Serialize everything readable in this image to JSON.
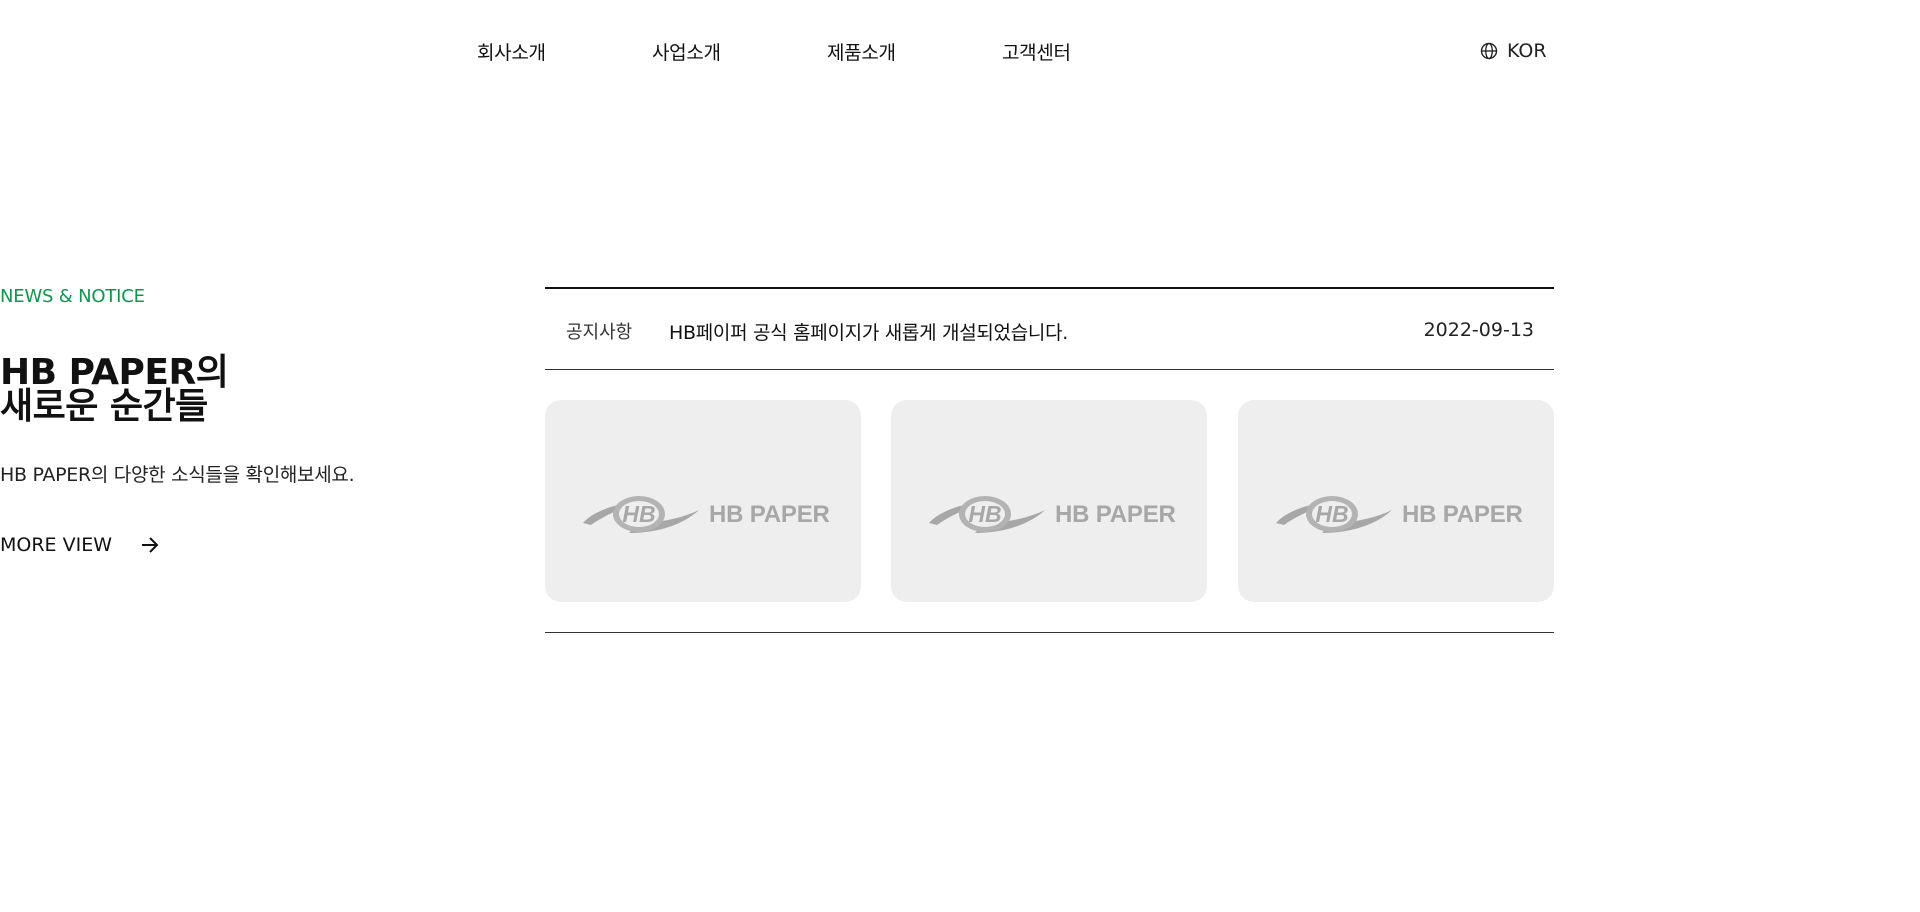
{
  "nav": {
    "items": [
      {
        "label": "회사소개"
      },
      {
        "label": "사업소개"
      },
      {
        "label": "제품소개"
      },
      {
        "label": "고객센터"
      }
    ],
    "language": {
      "label": "KOR",
      "icon": "globe-icon"
    }
  },
  "section": {
    "eyebrow": "NEWS & NOTICE",
    "heading_line1": "HB PAPER의",
    "heading_line2": "새로운 순간들",
    "subtext": "HB PAPER의 다양한 소식들을 확인해보세요.",
    "more_label": "MORE VIEW",
    "more_icon": "arrow-right-icon"
  },
  "notice": {
    "category": "공지사항",
    "title": "HB페이퍼 공식 홈페이지가 새롭게 개설되었습니다.",
    "date": "2022-09-13"
  },
  "cards": [
    {
      "logo_text": "HB PAPER"
    },
    {
      "logo_text": "HB PAPER"
    },
    {
      "logo_text": "HB PAPER"
    }
  ],
  "colors": {
    "accent": "#0a9a4a",
    "card_bg": "#eeeeee",
    "logo_gray": "#a7a7a7"
  }
}
